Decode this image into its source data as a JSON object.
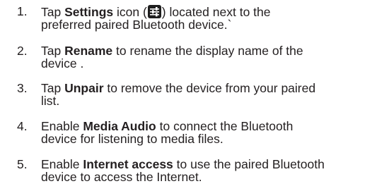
{
  "steps": [
    {
      "number": "1.",
      "pre": "Tap ",
      "bold": "Settings",
      "mid": " icon (",
      "icon": "settings-sliders-icon",
      "post": ") located next to the",
      "line2": "preferred paired Bluetooth device.`"
    },
    {
      "number": "2.",
      "pre": "Tap ",
      "bold": "Rename",
      "post": " to rename the display name of the",
      "line2": "device ."
    },
    {
      "number": "3.",
      "pre": "Tap ",
      "bold": "Unpair",
      "post": " to remove the device from your paired",
      "line2": "list."
    },
    {
      "number": "4.",
      "pre": "Enable ",
      "bold": "Media Audio",
      "post": " to connect the Bluetooth",
      "line2": "device for listening to media files."
    },
    {
      "number": "5.",
      "pre": "Enable ",
      "bold": "Internet access",
      "post": " to use the paired Bluetooth",
      "line2": "device to access the Internet."
    }
  ]
}
